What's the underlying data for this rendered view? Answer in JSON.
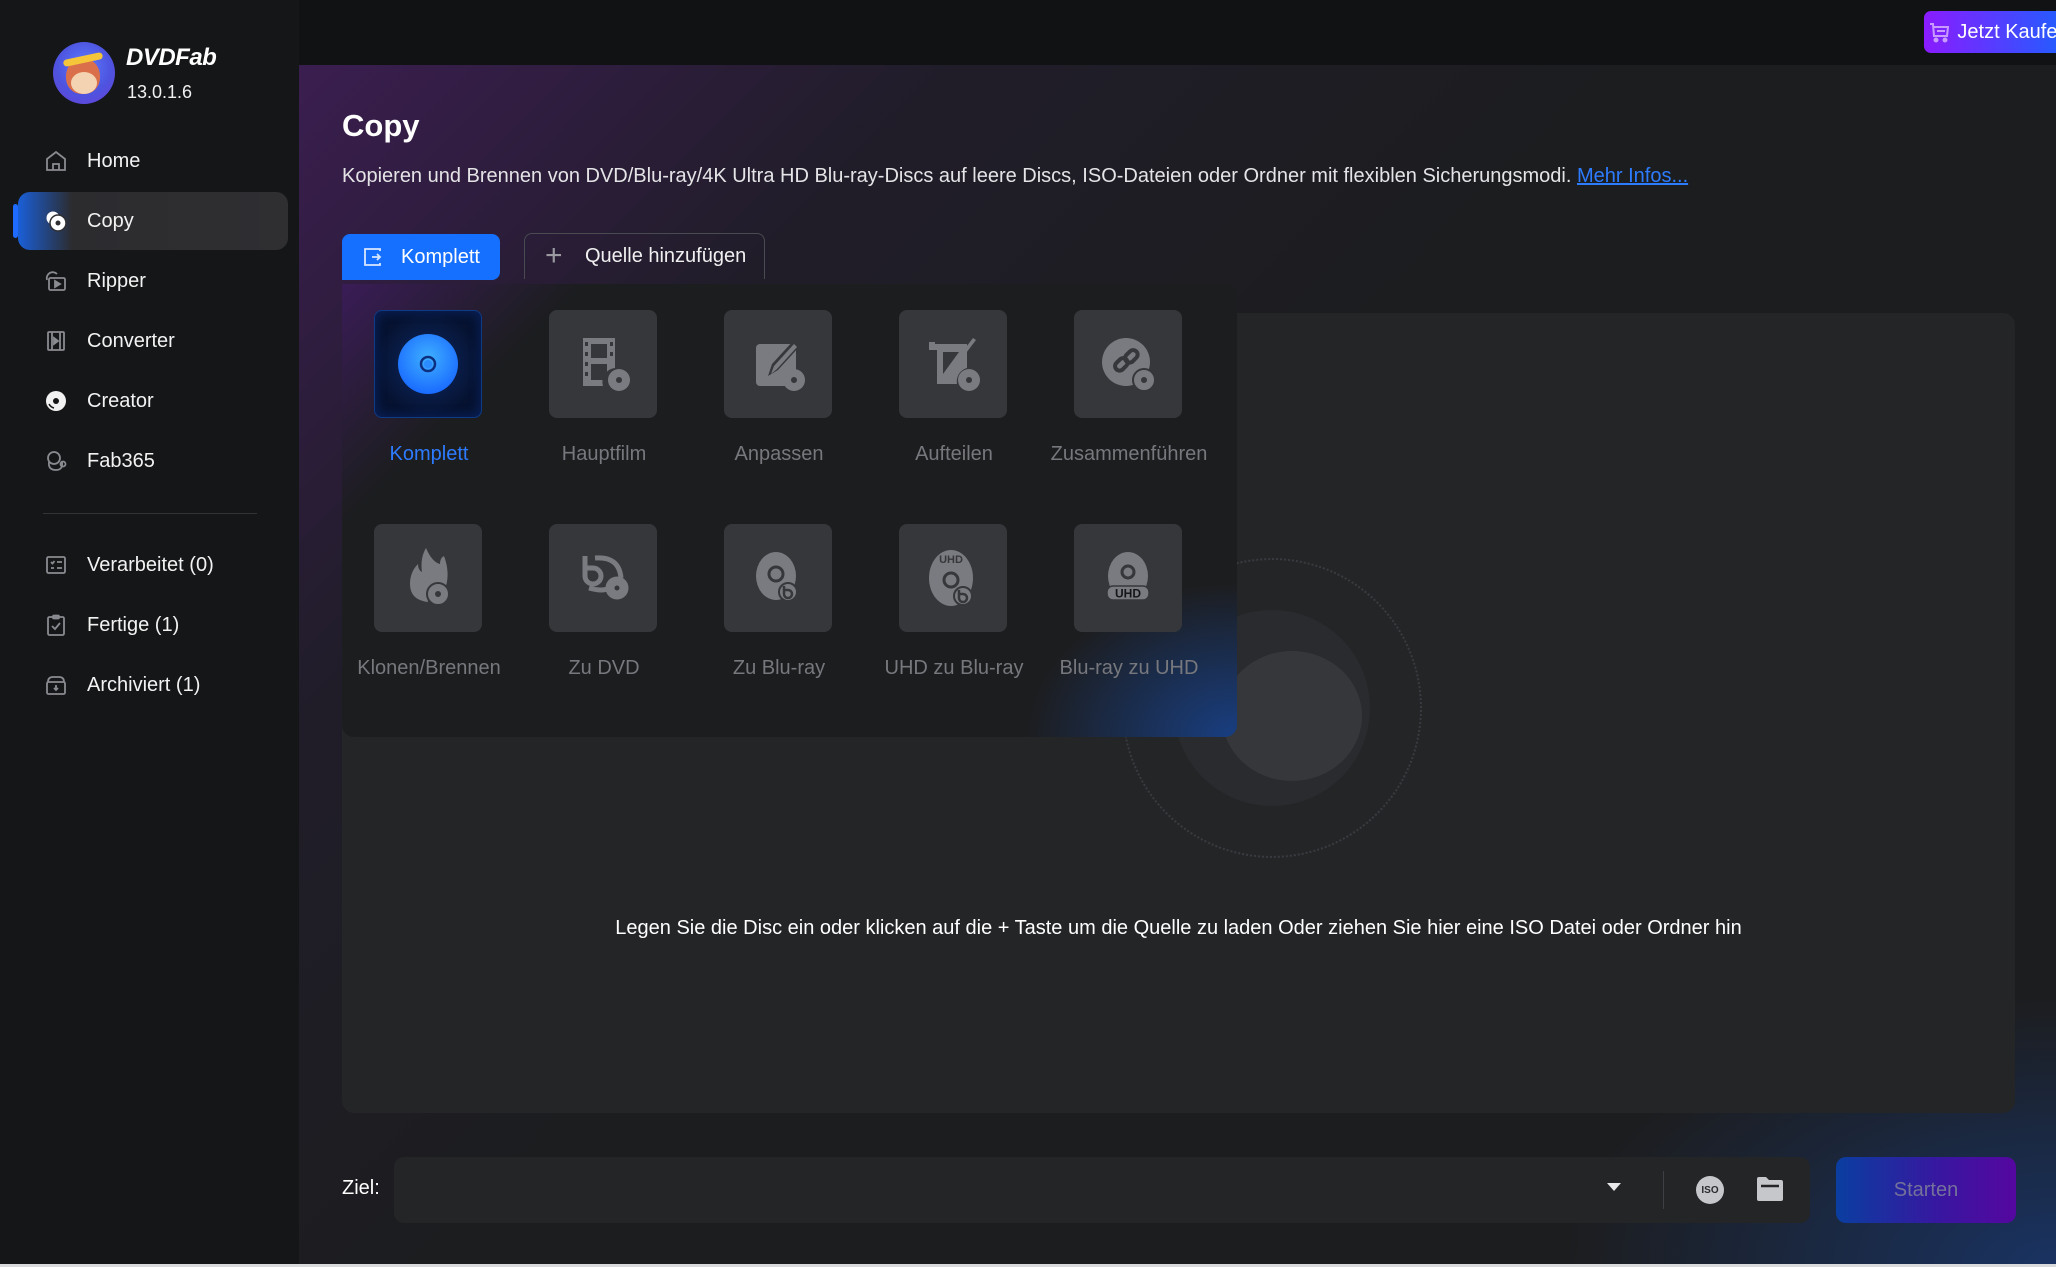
{
  "app": {
    "brand": "DVDFab",
    "version": "13.0.1.6"
  },
  "sidebar": {
    "items": [
      {
        "label": "Home",
        "icon": "home-icon",
        "active": false
      },
      {
        "label": "Copy",
        "icon": "copy-disc-icon",
        "active": true
      },
      {
        "label": "Ripper",
        "icon": "ripper-icon",
        "active": false
      },
      {
        "label": "Converter",
        "icon": "film-icon",
        "active": false
      },
      {
        "label": "Creator",
        "icon": "creator-disc-icon",
        "active": false
      },
      {
        "label": "Fab365",
        "icon": "fab365-icon",
        "active": false
      }
    ],
    "queue": [
      {
        "label": "Verarbeitet (0)",
        "icon": "task-list-icon"
      },
      {
        "label": "Fertige (1)",
        "icon": "clipboard-check-icon"
      },
      {
        "label": "Archiviert (1)",
        "icon": "archive-icon"
      }
    ]
  },
  "topbar": {
    "buy_label": "Jetzt Kaufen",
    "icons": [
      "shirt-icon",
      "menu-icon",
      "minimize-icon",
      "maximize-icon",
      "close-icon"
    ]
  },
  "main": {
    "title": "Copy",
    "description": "Kopieren und Brennen von DVD/Blu-ray/4K Ultra HD Blu-ray-Discs auf leere Discs, ISO-Dateien oder Ordner mit flexiblen Sicherungsmodi.",
    "more_info_link": "Mehr Infos...",
    "mode_button_label": "Komplett",
    "add_source_label": "Quelle hinzufügen",
    "drop_hint": "Legen Sie die Disc ein oder klicken auf die + Taste um die Quelle zu laden Oder ziehen Sie hier eine ISO Datei oder Ordner hin"
  },
  "modes": [
    {
      "label": "Komplett",
      "icon": "full-disc-icon",
      "selected": true
    },
    {
      "label": "Hauptfilm",
      "icon": "main-movie-icon",
      "selected": false
    },
    {
      "label": "Anpassen",
      "icon": "customize-icon",
      "selected": false
    },
    {
      "label": "Aufteilen",
      "icon": "split-icon",
      "selected": false
    },
    {
      "label": "Zusammenführen",
      "icon": "merge-icon",
      "selected": false
    },
    {
      "label": "Klonen/Brennen",
      "icon": "clone-burn-icon",
      "selected": false
    },
    {
      "label": "Zu DVD",
      "icon": "to-dvd-icon",
      "selected": false
    },
    {
      "label": "Zu Blu-ray",
      "icon": "to-bluray-icon",
      "selected": false
    },
    {
      "label": "UHD zu Blu-ray",
      "icon": "uhd-to-bluray-icon",
      "selected": false
    },
    {
      "label": "Blu-ray zu UHD",
      "icon": "bluray-to-uhd-icon",
      "selected": false
    }
  ],
  "bottom": {
    "target_label": "Ziel:",
    "target_value": "",
    "iso_label": "ISO",
    "start_label": "Starten"
  },
  "colors": {
    "accent": "#1570ff",
    "link": "#2d7bff",
    "buy_gradient_start": "#8a1cff",
    "buy_gradient_end": "#1a62ff"
  }
}
